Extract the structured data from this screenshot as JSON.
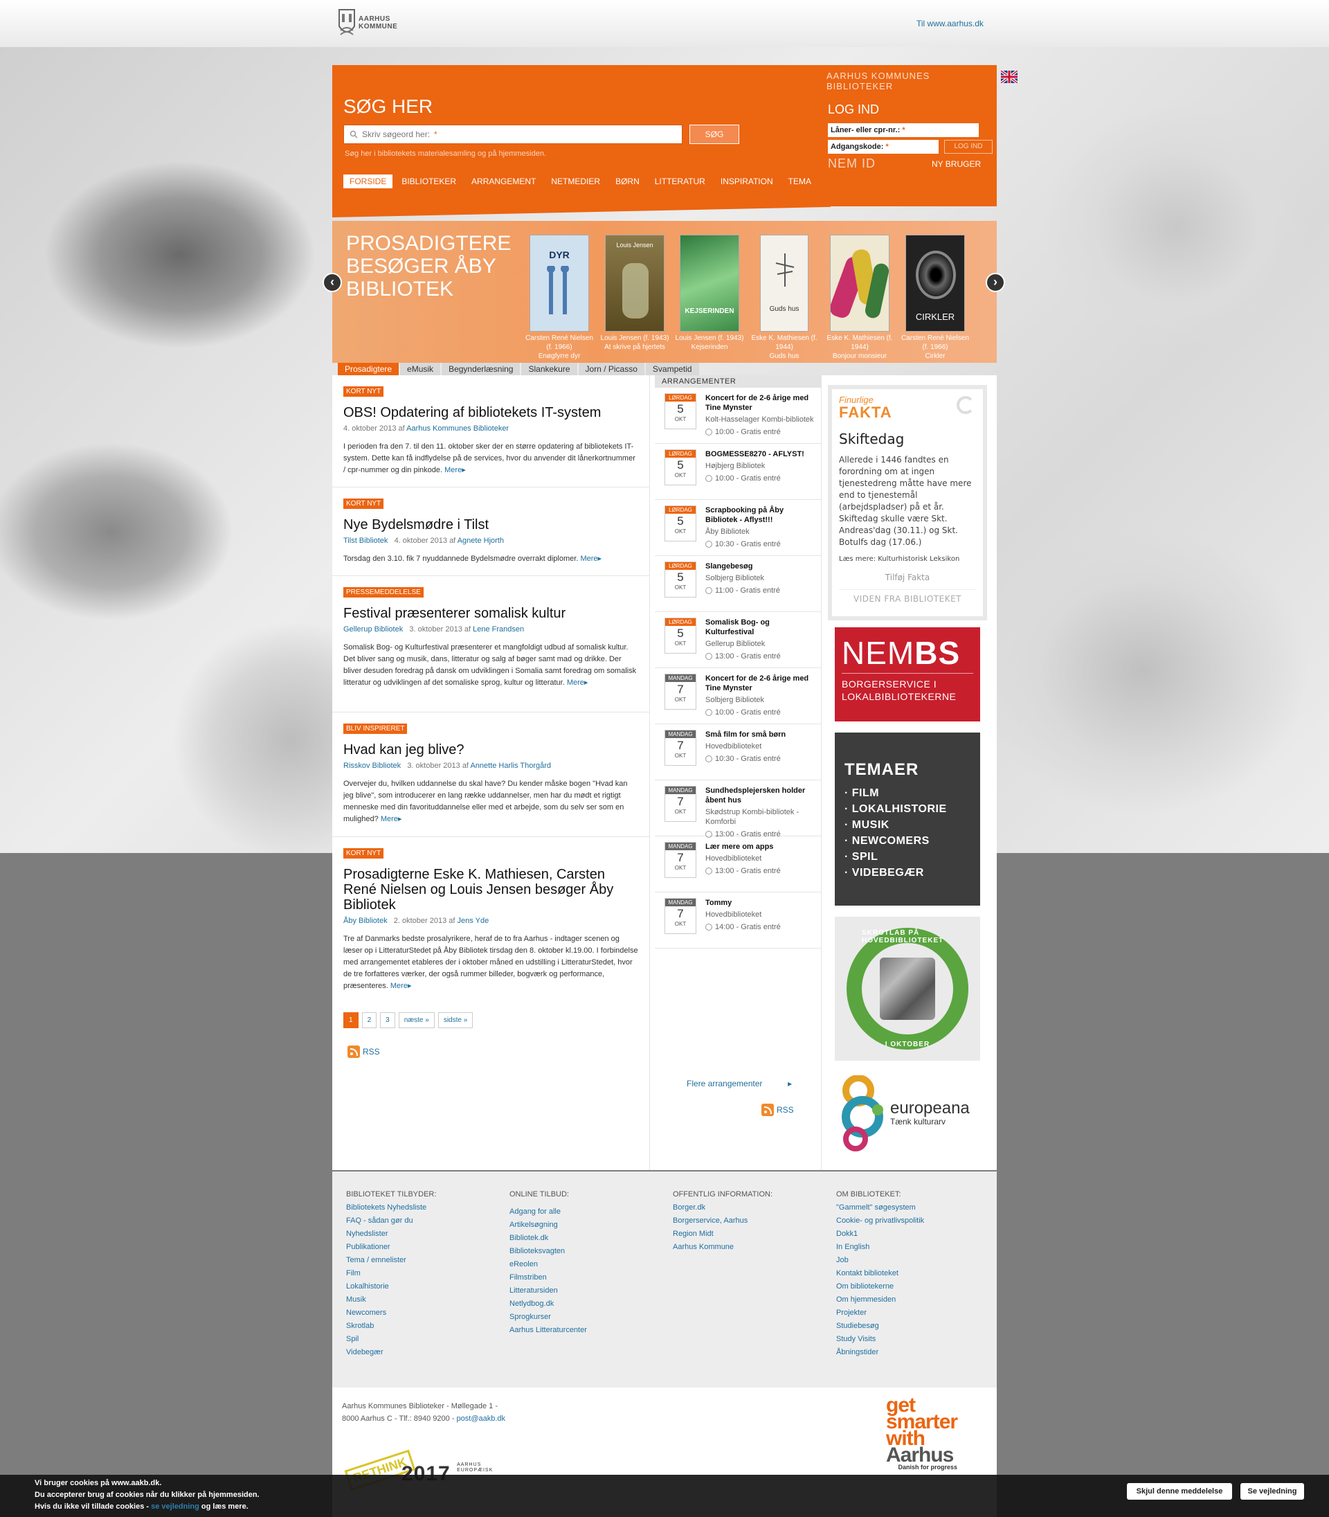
{
  "header": {
    "logo_line1": "AARHUS",
    "logo_line2": "KOMMUNE",
    "to_link": "Til www.aarhus.dk"
  },
  "search": {
    "library_title": "AARHUS KOMMUNES BIBLIOTEKER",
    "heading": "SØG HER",
    "placeholder": "Skriv søgeord her:",
    "required_mark": "*",
    "button": "SØG",
    "note": "Søg her i bibliotekets materialesamling og på hjemmesiden."
  },
  "login": {
    "heading": "LOG IND",
    "user_label": "Låner- eller cpr-nr.:",
    "password_label": "Adgangskode:",
    "required_mark": "*",
    "button": "LOG IND",
    "nemid": "NEM ID",
    "new_user": "NY BRUGER"
  },
  "nav": [
    {
      "label": "FORSIDE",
      "active": true
    },
    {
      "label": "BIBLIOTEKER"
    },
    {
      "label": "ARRANGEMENT"
    },
    {
      "label": "NETMEDIER"
    },
    {
      "label": "BØRN"
    },
    {
      "label": "LITTERATUR"
    },
    {
      "label": "INSPIRATION"
    },
    {
      "label": "TEMA"
    }
  ],
  "carousel": {
    "heading": "PROSADIGTERE BESØGER ÅBY BIBLIOTEK",
    "books": [
      {
        "author": "Carsten René Nielsen (f. 1966)",
        "title": "Enøgfyrre dyr",
        "cover_color": "#cfe0ef",
        "cover_text": "DYR"
      },
      {
        "author": "Louis Jensen (f. 1943)",
        "title": "At skrive på hjertets",
        "cover_color": "#6d5a2e",
        "cover_text": "Louis Jensen"
      },
      {
        "author": "Louis Jensen (f. 1943)",
        "title": "Kejserinden",
        "cover_color": "#4a9b5a",
        "cover_text": "KEJSERINDEN"
      },
      {
        "author": "Eske K. Mathiesen (f. 1944)",
        "title": "Guds hus",
        "cover_color": "#f4f1ea",
        "cover_text": "Guds hus"
      },
      {
        "author": "Eske K. Mathiesen (f. 1944)",
        "title": "Bonjour monsieur",
        "cover_color": "#e8d6a8",
        "cover_text": ""
      },
      {
        "author": "Carsten René Nielsen (f. 1966)",
        "title": "Cirkler",
        "cover_color": "#2a2a2a",
        "cover_text": "CIRKLER"
      }
    ]
  },
  "subtabs": [
    {
      "label": "Prosadigtere",
      "active": true
    },
    {
      "label": "eMusik"
    },
    {
      "label": "Begynderlæsning"
    },
    {
      "label": "Slankekure"
    },
    {
      "label": "Jorn / Picasso"
    },
    {
      "label": "Svampetid"
    }
  ],
  "news": [
    {
      "tag": "KORT NYT",
      "title": "OBS! Opdatering af bibliotekets IT-system",
      "date": "4. oktober 2013 af",
      "author": "Aarhus Kommunes Biblioteker",
      "source": "",
      "text": "I perioden fra den 7. til den 11. oktober sker der en større opdatering af bibliotekets IT-system. Dette kan få indflydelse på de services, hvor du anvender dit lånerkortnummer / cpr-nummer og din pinkode.",
      "more": "Mere"
    },
    {
      "tag": "KORT NYT",
      "title": "Nye Bydelsmødre i Tilst",
      "source": "Tilst Bibliotek",
      "date": "4. oktober 2013 af",
      "author": "Agnete Hjorth",
      "text": "Torsdag den 3.10. fik 7 nyuddannede Bydelsmødre overrakt diplomer.",
      "more": "Mere"
    },
    {
      "tag": "PRESSEMEDDELELSE",
      "title": "Festival præsenterer somalisk kultur",
      "source": "Gellerup Bibliotek",
      "date": "3. oktober 2013 af",
      "author": "Lene Frandsen",
      "text": "Somalisk Bog- og Kulturfestival præsenterer et mangfoldigt udbud af somalisk kultur. Det bliver sang og musik, dans, litteratur og salg af bøger samt mad og drikke. Der bliver desuden foredrag på dansk om udviklingen i Somalia samt foredrag om somalisk litteratur og udviklingen af det somaliske sprog, kultur og litteratur.",
      "more": "Mere"
    },
    {
      "tag": "BLIV INSPIRERET",
      "title": "Hvad kan jeg blive?",
      "source": "Risskov Bibliotek",
      "date": "3. oktober 2013 af",
      "author": "Annette Harlis Thorgård",
      "text": "Overvejer du, hvilken uddannelse du skal have? Du kender måske bogen \"Hvad kan jeg blive\", som introducerer en lang række uddannelser, men har du mødt et rigtigt menneske med din favorituddannelse eller med et arbejde, som du selv ser som en mulighed?",
      "more": "Mere"
    },
    {
      "tag": "KORT NYT",
      "title": "Prosadigterne Eske K. Mathiesen, Carsten René Nielsen og Louis Jensen besøger Åby Bibliotek",
      "source": "Åby Bibliotek",
      "date": "2. oktober 2013 af",
      "author": "Jens Yde",
      "text": "Tre af Danmarks bedste prosalyrikere, heraf de to fra Aarhus - indtager scenen og læser op i LitteraturStedet på Åby Bibliotek tirsdag den 8. oktober kl.19.00. I forbindelse med arrangementet etableres der i oktober måned en udstilling i LitteraturStedet, hvor de tre forfatteres værker, der også rummer billeder, bogværk og performance, præsenteres.",
      "more": "Mere"
    }
  ],
  "pager": {
    "pages": [
      "1",
      "2",
      "3"
    ],
    "next": "næste »",
    "last": "sidste »"
  },
  "rss": "RSS",
  "events": {
    "heading": "ARRANGEMENTER",
    "more": "Flere arrangementer",
    "items": [
      {
        "day": "LØRDAG",
        "num": "5",
        "month": "OKT",
        "title": "Koncert for de 2-6 årige med Tine Mynster",
        "place": "Kolt-Hasselager Kombi-bibliotek",
        "time": "10:00 - Gratis entré",
        "grey": false
      },
      {
        "day": "LØRDAG",
        "num": "5",
        "month": "OKT",
        "title": "BOGMESSE8270 - AFLYST!",
        "place": "Højbjerg Bibliotek",
        "time": "10:00 - Gratis entré",
        "grey": false
      },
      {
        "day": "LØRDAG",
        "num": "5",
        "month": "OKT",
        "title": "Scrapbooking på Åby Bibliotek - Aflyst!!!",
        "place": "Åby Bibliotek",
        "time": "10:30 - Gratis entré",
        "grey": false
      },
      {
        "day": "LØRDAG",
        "num": "5",
        "month": "OKT",
        "title": "Slangebesøg",
        "place": "Solbjerg Bibliotek",
        "time": "11:00 - Gratis entré",
        "grey": false
      },
      {
        "day": "LØRDAG",
        "num": "5",
        "month": "OKT",
        "title": "Somalisk Bog- og Kulturfestival",
        "place": "Gellerup Bibliotek",
        "time": "13:00 - Gratis entré",
        "grey": false
      },
      {
        "day": "MANDAG",
        "num": "7",
        "month": "OKT",
        "title": "Koncert for de 2-6 årige med Tine Mynster",
        "place": "Solbjerg Bibliotek",
        "time": "10:00 - Gratis entré",
        "grey": true
      },
      {
        "day": "MANDAG",
        "num": "7",
        "month": "OKT",
        "title": "Små film for små børn",
        "place": "Hovedbiblioteket",
        "time": "10:30 - Gratis entré",
        "grey": true
      },
      {
        "day": "MANDAG",
        "num": "7",
        "month": "OKT",
        "title": "Sundhedsplejersken holder åbent hus",
        "place": "Skødstrup Kombi-bibliotek - Komforbi",
        "time": "13:00 - Gratis entré",
        "grey": true
      },
      {
        "day": "MANDAG",
        "num": "7",
        "month": "OKT",
        "title": "Lær mere om apps",
        "place": "Hovedbiblioteket",
        "time": "13:00 - Gratis entré",
        "grey": true
      },
      {
        "day": "MANDAG",
        "num": "7",
        "month": "OKT",
        "title": "Tommy",
        "place": "Hovedbiblioteket",
        "time": "14:00 - Gratis entré",
        "grey": true
      }
    ]
  },
  "fakta": {
    "logo_top": "Finurlige",
    "logo_bottom": "FAKTA",
    "title": "Skiftedag",
    "text": "Allerede i 1446 fandtes en forordning om at ingen tjenestedreng måtte have mere end to tjenestemål (arbejdspladser) på et år. Skiftedag skulle være Skt. Andreas'dag (30.11.) og Skt. Botulfs dag (17.06.)",
    "read_more": "Læs mere: Kulturhistorisk Leksikon",
    "add": "Tilføj Fakta",
    "viden": "VIDEN FRA BIBLIOTEKET"
  },
  "banners": {
    "nembs": {
      "nem": "NEM",
      "bs": "BS",
      "sub1": "BORGERSERVICE I",
      "sub2": "LOKALBIBLIOTEKERNE"
    },
    "temaer": {
      "head": "TEMAER",
      "items": [
        "· FILM",
        "· LOKALHISTORIE",
        "· MUSIK",
        "· NEWCOMERS",
        "· SPIL",
        "· VIDEBEGÆR"
      ]
    },
    "skrotlab": {
      "top": "SKROTLAB PÅ HOVEDBIBLIOTEKET",
      "bottom": "I OKTOBER"
    },
    "europeana": {
      "word": "europeana",
      "tagline": "Tænk kulturarv"
    }
  },
  "footer": {
    "cols": [
      {
        "head": "BIBLIOTEKET TILBYDER:",
        "links": [
          "Bibliotekets Nyhedsliste",
          "FAQ - sådan gør du",
          "Nyhedslister",
          "Publikationer",
          "Tema / emnelister",
          "Film",
          "Lokalhistorie",
          "Musik",
          "Newcomers",
          "Skrotlab",
          "Spil",
          "Videbegær"
        ]
      },
      {
        "head": "ONLINE TILBUD:",
        "links": [
          "Adgang for alle",
          "Artikelsøgning",
          "Bibliotek.dk",
          "Biblioteksvagten",
          "eReolen",
          "Filmstriben",
          "Litteratursiden",
          "Netlydbog.dk",
          "Sprogkurser",
          "Aarhus Litteraturcenter"
        ]
      },
      {
        "head": "OFFENTLIG INFORMATION:",
        "links": [
          "Borger.dk",
          "Borgerservice, Aarhus",
          "Region Midt",
          "Aarhus Kommune"
        ]
      },
      {
        "head": "OM BIBLIOTEKET:",
        "links": [
          "\"Gammelt\" søgesystem",
          "Cookie- og privatlivspolitik",
          "Dokk1",
          "In English",
          "Job",
          "Kontakt biblioteket",
          "Om bibliotekerne",
          "Om hjemmesiden",
          "Projekter",
          "Studiebesøg",
          "Study Visits",
          "Åbningstider"
        ]
      }
    ]
  },
  "address": {
    "line1": "Aarhus Kommunes Biblioteker - Møllegade 1 -",
    "line2": "8000 Aarhus C - Tlf.: 8940 9200 -",
    "email": "post@aakb.dk",
    "smarter1": "get",
    "smarter2": "smarter",
    "smarter3": "with",
    "smarter4": "Aarhus",
    "smarter_sub": "Danish for progress",
    "rethink": "RETHINK",
    "year": "2017",
    "year_sub1": "AARHUS",
    "year_sub2": "EUROPÆISK"
  },
  "cookie": {
    "line1": "Vi bruger cookies på www.aakb.dk.",
    "line2": "Du accepterer brug af cookies når du klikker på hjemmesiden.",
    "line3a": "Hvis du ikke vil tillade cookies -",
    "line3link": "se vejledning",
    "line3b": "og læs mere.",
    "hide": "Skjul denne meddelelse",
    "guide": "Se vejledning"
  },
  "colors": {
    "accent": "#ec6511",
    "link": "#1f6f9c",
    "nembs": "#c81f2d"
  }
}
